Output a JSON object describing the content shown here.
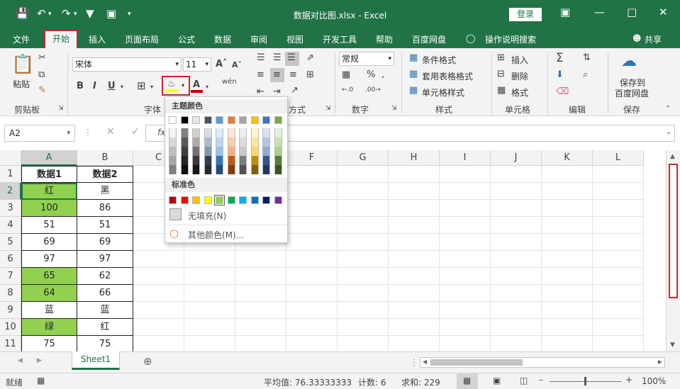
{
  "title": "数据对比图.xlsx  -  Excel",
  "login_label": "登录",
  "tabs": [
    "文件",
    "开始",
    "插入",
    "页面布局",
    "公式",
    "数据",
    "审阅",
    "视图",
    "开发工具",
    "帮助",
    "百度网盘"
  ],
  "tell_me": "操作说明搜索",
  "share": "共享",
  "ribbon": {
    "paste": "粘贴",
    "clipboard": "剪贴板",
    "font_name": "宋体",
    "font_size": "11",
    "font_group": "字体",
    "align_group": "方式",
    "number_format": "常规",
    "number_group": "数字",
    "cond_format": "条件格式",
    "table_format": "套用表格格式",
    "cell_style": "单元格样式",
    "style_group": "样式",
    "insert": "插入",
    "delete": "删除",
    "format": "格式",
    "cells_group": "单元格",
    "editing_group": "编辑",
    "save_to": "保存到",
    "baidu_disk": "百度网盘",
    "save_group": "保存",
    "bold": "B",
    "italic": "I",
    "underline": "U",
    "font_color_label": "A",
    "phonetic": "wén",
    "percent": "%"
  },
  "name_box": "A2",
  "formula_fx": "fx",
  "columns": [
    "A",
    "B",
    "C",
    "D",
    "E",
    "F",
    "G",
    "H",
    "I",
    "J",
    "K",
    "L"
  ],
  "rows": [
    {
      "n": "1",
      "a": "数据1",
      "b": "数据2",
      "header": true
    },
    {
      "n": "2",
      "a": "红",
      "b": "黑",
      "fill": true
    },
    {
      "n": "3",
      "a": "100",
      "b": "86",
      "fill": true
    },
    {
      "n": "4",
      "a": "51",
      "b": "51",
      "fill": false
    },
    {
      "n": "5",
      "a": "69",
      "b": "69",
      "fill": false
    },
    {
      "n": "6",
      "a": "97",
      "b": "97",
      "fill": false
    },
    {
      "n": "7",
      "a": "65",
      "b": "62",
      "fill": true
    },
    {
      "n": "8",
      "a": "64",
      "b": "66",
      "fill": true
    },
    {
      "n": "9",
      "a": "蓝",
      "b": "蓝",
      "fill": false
    },
    {
      "n": "10",
      "a": "绿",
      "b": "红",
      "fill": true
    },
    {
      "n": "11",
      "a": "75",
      "b": "75",
      "fill": false
    }
  ],
  "palette": {
    "theme_title": "主题颜色",
    "standard_title": "标准色",
    "no_fill": "无填充(N)",
    "more_colors": "其他颜色(M)...",
    "theme_top": [
      "#ffffff",
      "#000000",
      "#e7e6e6",
      "#44546a",
      "#5b9bd5",
      "#ed7d31",
      "#a5a5a5",
      "#ffc000",
      "#4472c4",
      "#70ad47"
    ],
    "theme_cols": [
      [
        "#f2f2f2",
        "#d9d9d9",
        "#bfbfbf",
        "#a6a6a6",
        "#808080"
      ],
      [
        "#808080",
        "#595959",
        "#404040",
        "#262626",
        "#0d0d0d"
      ],
      [
        "#d0cece",
        "#aeaaaa",
        "#767171",
        "#3a3838",
        "#171616"
      ],
      [
        "#d6dce4",
        "#adb9ca",
        "#8497b0",
        "#333f4f",
        "#222a35"
      ],
      [
        "#ddebf7",
        "#bdd7ee",
        "#9bc2e6",
        "#2f75b5",
        "#1f4e78"
      ],
      [
        "#fce4d6",
        "#f8cbad",
        "#f4b084",
        "#c65911",
        "#833c0c"
      ],
      [
        "#ededed",
        "#dbdbdb",
        "#c9c9c9",
        "#7b7b7b",
        "#525252"
      ],
      [
        "#fff2cc",
        "#ffe699",
        "#ffd966",
        "#bf8f00",
        "#806000"
      ],
      [
        "#d9e1f2",
        "#b4c6e7",
        "#8ea9db",
        "#305496",
        "#203764"
      ],
      [
        "#e2efda",
        "#c6e0b4",
        "#a9d08e",
        "#548235",
        "#375623"
      ]
    ],
    "standard": [
      "#c00000",
      "#ff0000",
      "#ffc000",
      "#ffff00",
      "#92d050",
      "#00b050",
      "#00b0f0",
      "#0070c0",
      "#002060",
      "#7030a0"
    ]
  },
  "sheet_tab": "Sheet1",
  "status": {
    "ready": "就绪",
    "average": "平均值: 76.33333333",
    "count": "计数: 6",
    "sum": "求和: 229",
    "zoom": "100%"
  },
  "colors": {
    "accent": "#217346",
    "green_fill": "#92d050",
    "highlight": "#c8282e"
  }
}
